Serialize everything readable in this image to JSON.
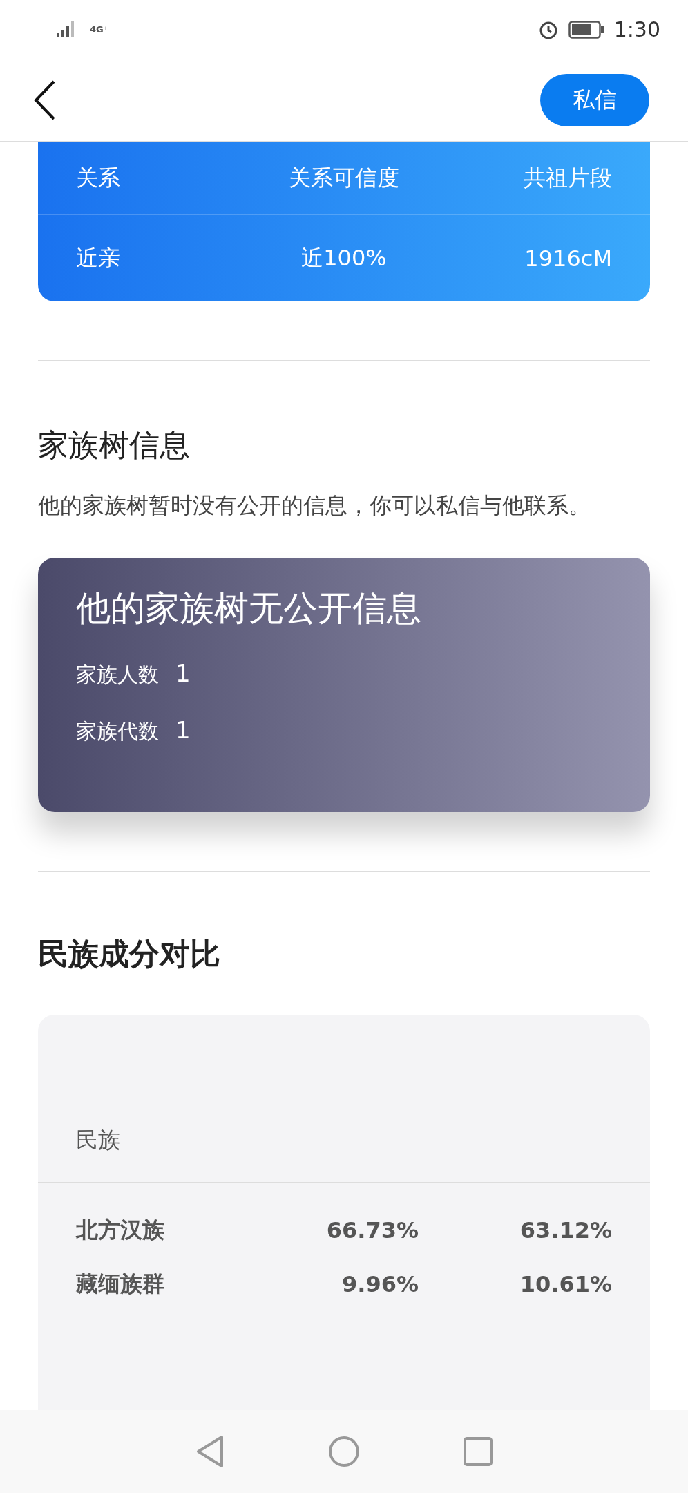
{
  "status_bar": {
    "network": "4G⁺",
    "time": "1:30"
  },
  "header": {
    "message_button": "私信"
  },
  "relation_table": {
    "columns": [
      "关系",
      "关系可信度",
      "共祖片段"
    ],
    "values": [
      "近亲",
      "近100%",
      "1916cM"
    ]
  },
  "family_tree": {
    "title": "家族树信息",
    "description": "他的家族树暂时没有公开的信息，你可以私信与他联系。",
    "card": {
      "title": "他的家族树无公开信息",
      "stats": [
        {
          "label": "家族人数",
          "value": "1"
        },
        {
          "label": "家族代数",
          "value": "1"
        }
      ]
    }
  },
  "ethnicity": {
    "title": "民族成分对比",
    "column_1": "民族",
    "rows": [
      {
        "name": "北方汉族",
        "values": [
          "66.73%",
          "63.12%"
        ]
      },
      {
        "name": "藏缅族群",
        "values": [
          "9.96%",
          "10.61%"
        ]
      }
    ]
  }
}
